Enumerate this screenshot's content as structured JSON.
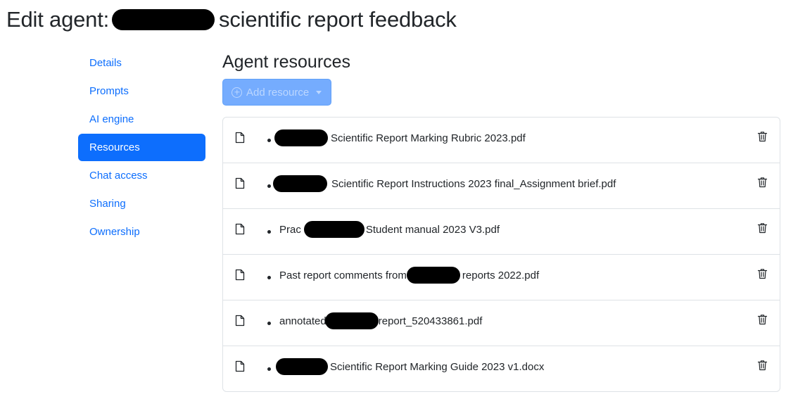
{
  "page": {
    "title_prefix": "Edit agent:",
    "title_suffix": "scientific report feedback"
  },
  "nav": {
    "items": [
      {
        "label": "Details"
      },
      {
        "label": "Prompts"
      },
      {
        "label": "AI engine"
      },
      {
        "label": "Resources",
        "active": true
      },
      {
        "label": "Chat access"
      },
      {
        "label": "Sharing"
      },
      {
        "label": "Ownership"
      }
    ]
  },
  "main": {
    "title": "Agent resources",
    "add_button_label": "Add resource",
    "resources": [
      {
        "before": "",
        "after": "Scientific Report Marking Rubric 2023.pdf"
      },
      {
        "before": "",
        "after": "Scientific Report Instructions 2023 final_Assignment brief.pdf"
      },
      {
        "before": "Prac",
        "after": "Student manual 2023 V3.pdf"
      },
      {
        "before": "Past report comments from",
        "after": "reports 2022.pdf"
      },
      {
        "before": "annotated",
        "after": "report_520433861.pdf"
      },
      {
        "before": "",
        "after": "Scientific Report Marking Guide 2023 v1.docx"
      }
    ]
  },
  "colors": {
    "primary": "#0d6efd",
    "primary_disabled": "#6ea8fe",
    "border": "#dee2e6",
    "text": "#212529",
    "redaction": "#000000"
  },
  "icons": {
    "resource": "file-icon",
    "delete": "trash-icon",
    "add": "plus-circle-icon",
    "dropdown": "caret-down-icon"
  }
}
